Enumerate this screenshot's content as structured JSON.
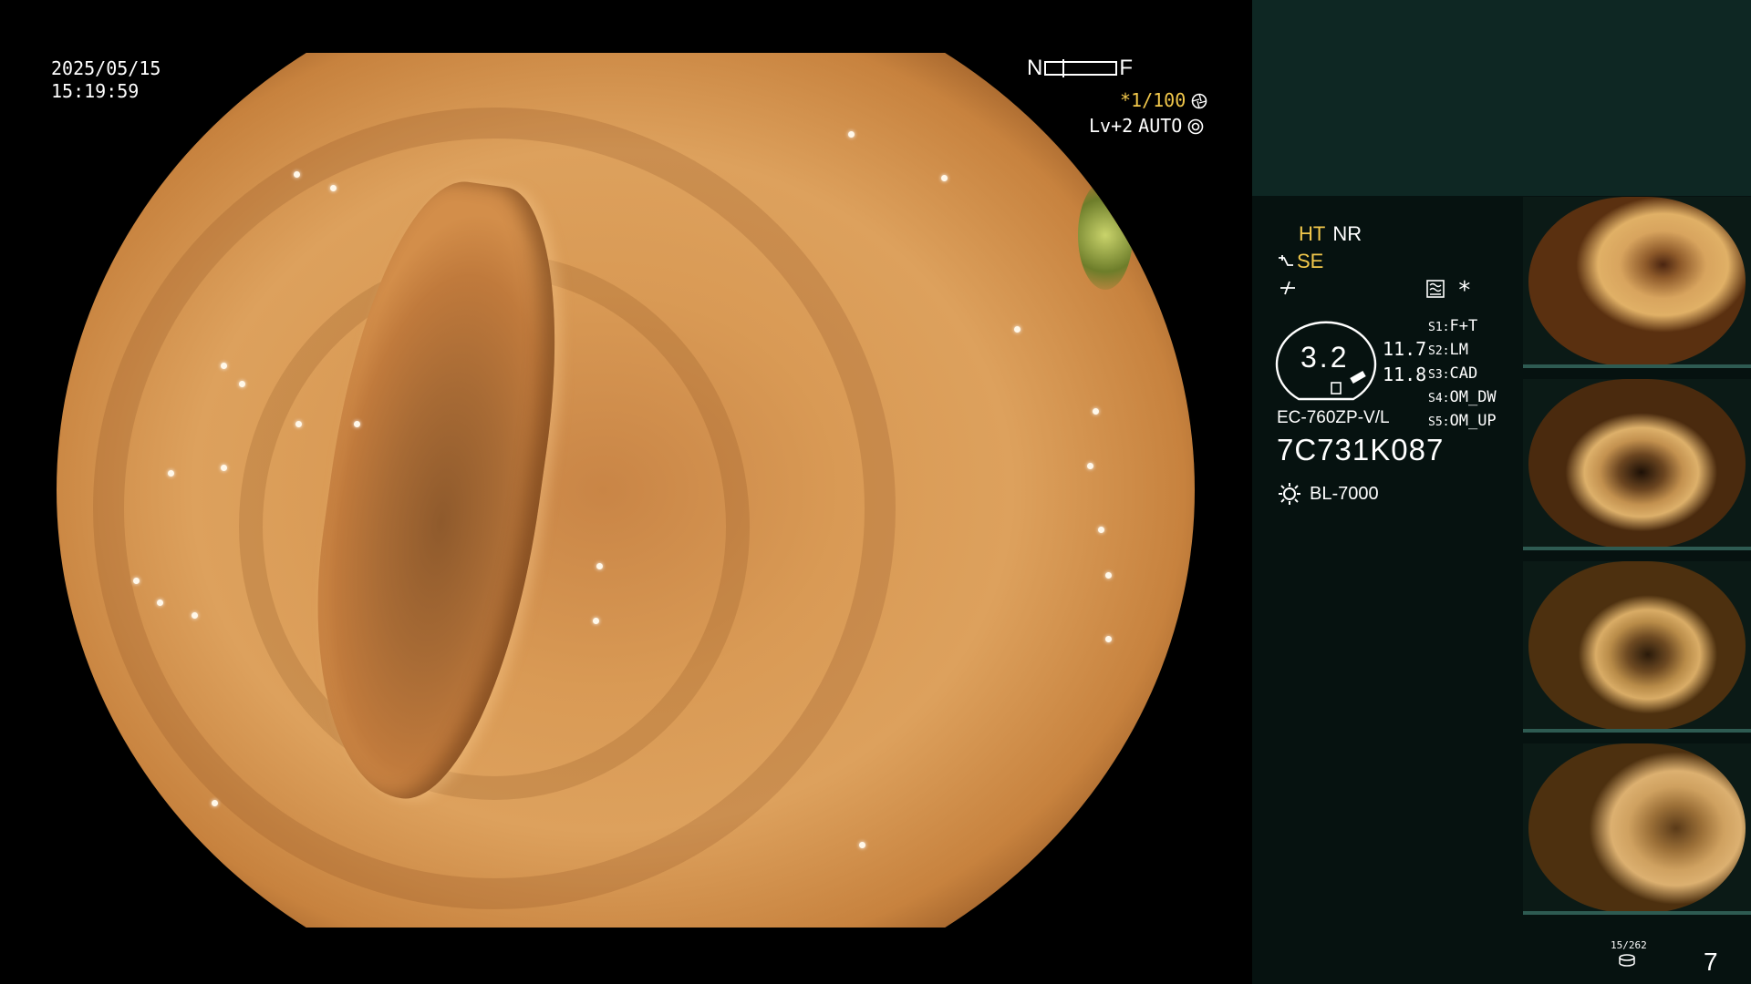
{
  "header": {
    "date": "2025/05/15",
    "time": "15:19:59"
  },
  "focus_indicator": {
    "near_label": "N",
    "far_label": "F"
  },
  "shutter": {
    "value": "*1/100",
    "icon": "aperture-icon"
  },
  "iris": {
    "level": "Lv+2",
    "mode": "AUTO",
    "icon": "iris-icon"
  },
  "processing": {
    "ht": "HT",
    "nr": "NR",
    "se": "SE",
    "se_icon": "enhance-icon",
    "filter_icon": "filter-icon",
    "mode_icon": "wave-icon",
    "star": "*"
  },
  "zoom": {
    "value": "3.2",
    "side_top": "11.7",
    "side_bottom": "11.8"
  },
  "scope_switches": [
    {
      "key": "S1:",
      "value": "F+T"
    },
    {
      "key": "S2:",
      "value": "LM"
    },
    {
      "key": "S3:",
      "value": "CAD"
    },
    {
      "key": "S4:",
      "value": "OM_DW"
    },
    {
      "key": "S5:",
      "value": "OM_UP"
    }
  ],
  "scope": {
    "model": "EC-760ZP-V/L",
    "serial": "7C731K087",
    "light_source": "BL-7000",
    "light_icon": "sun-icon"
  },
  "footer": {
    "counter": "15/262",
    "disk_icon": "disk-icon",
    "image_count": "7"
  },
  "colors": {
    "accent_yellow": "#f2c84b",
    "panel_bg": "#061210",
    "panel_top_bg": "#0e2723",
    "thumb_bar": "#2e5b52"
  }
}
